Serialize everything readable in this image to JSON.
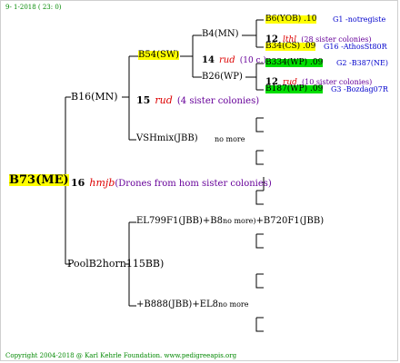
{
  "header": {
    "date": "9- 1-2018 ( 23: 0)"
  },
  "root": {
    "label": "B73(ME)",
    "gen_num": "16",
    "gen_name": "hmjb",
    "gen_note": "(Drones from hom sister colonies)",
    "color": "#ffff00"
  },
  "upper": {
    "label": "B16(MN)",
    "gen_num": "15",
    "gen_name": "rud",
    "gen_note": "(4 sister colonies)",
    "b54": {
      "label": "B54(SW)",
      "gen_num": "14",
      "gen_name": "rud",
      "gen_note": "(10 c.)",
      "b4": {
        "label": "B4(MN)",
        "gen_num": "12",
        "gen_name": "lthl",
        "gen_note": "(28 sister colonies)",
        "b6": {
          "label": "B6(YOB) .10",
          "note": "G1 -notregiste"
        },
        "b34": {
          "label": "B34(CS) .09",
          "note": "G16 -AthosSt80R"
        }
      },
      "b26": {
        "label": "B26(WP)",
        "gen_num": "12",
        "gen_name": "rud",
        "gen_note": "(10 sister colonies)",
        "b334": {
          "label": "B334(WP) .09",
          "note": "G2 -B387(NE)"
        },
        "b187": {
          "label": "B187(WP) .09",
          "note": "G3 -Bozdag07R"
        }
      }
    },
    "vsh": {
      "label": "VSHmix(JBB)",
      "note": "no more"
    }
  },
  "lower": {
    "label": "PoolB2horn115BB)",
    "el799": {
      "label": "EL799F1(JBB)+B8",
      "note": "no more)",
      "tail": "+B720F1(JBB)"
    },
    "b888": {
      "label": "+B888(JBB)+EL8",
      "note": "no more"
    }
  },
  "footer": {
    "text": "Copyright 2004-2018 @ Karl Kehrle Foundation.   www.pedigreeapis.org"
  },
  "colors": {
    "yellow": "#ffff00",
    "green": "#00dd00",
    "lines": "#000000",
    "accent_blue": "#0000cc"
  }
}
